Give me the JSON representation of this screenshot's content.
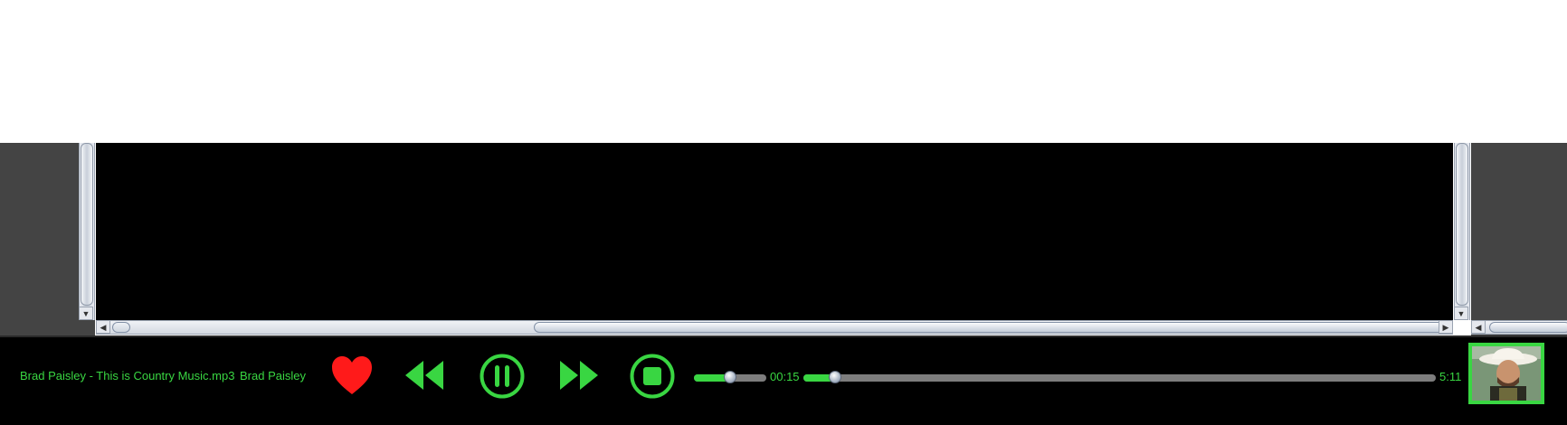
{
  "player": {
    "track_file": "Brad Paisley - This is Country Music.mp3",
    "artist": "Brad Paisley",
    "volume_fraction": 0.5,
    "elapsed": "00:15",
    "duration": "5:11",
    "progress_fraction": 0.05,
    "accent_color": "#39d642",
    "favorite_color": "#ff1a1a",
    "controls": [
      "heart-icon",
      "rewind-icon",
      "pause-icon",
      "fast-forward-icon",
      "stop-icon"
    ]
  },
  "scrollbars": {
    "arrows": [
      "▼",
      "◀",
      "▶"
    ]
  }
}
